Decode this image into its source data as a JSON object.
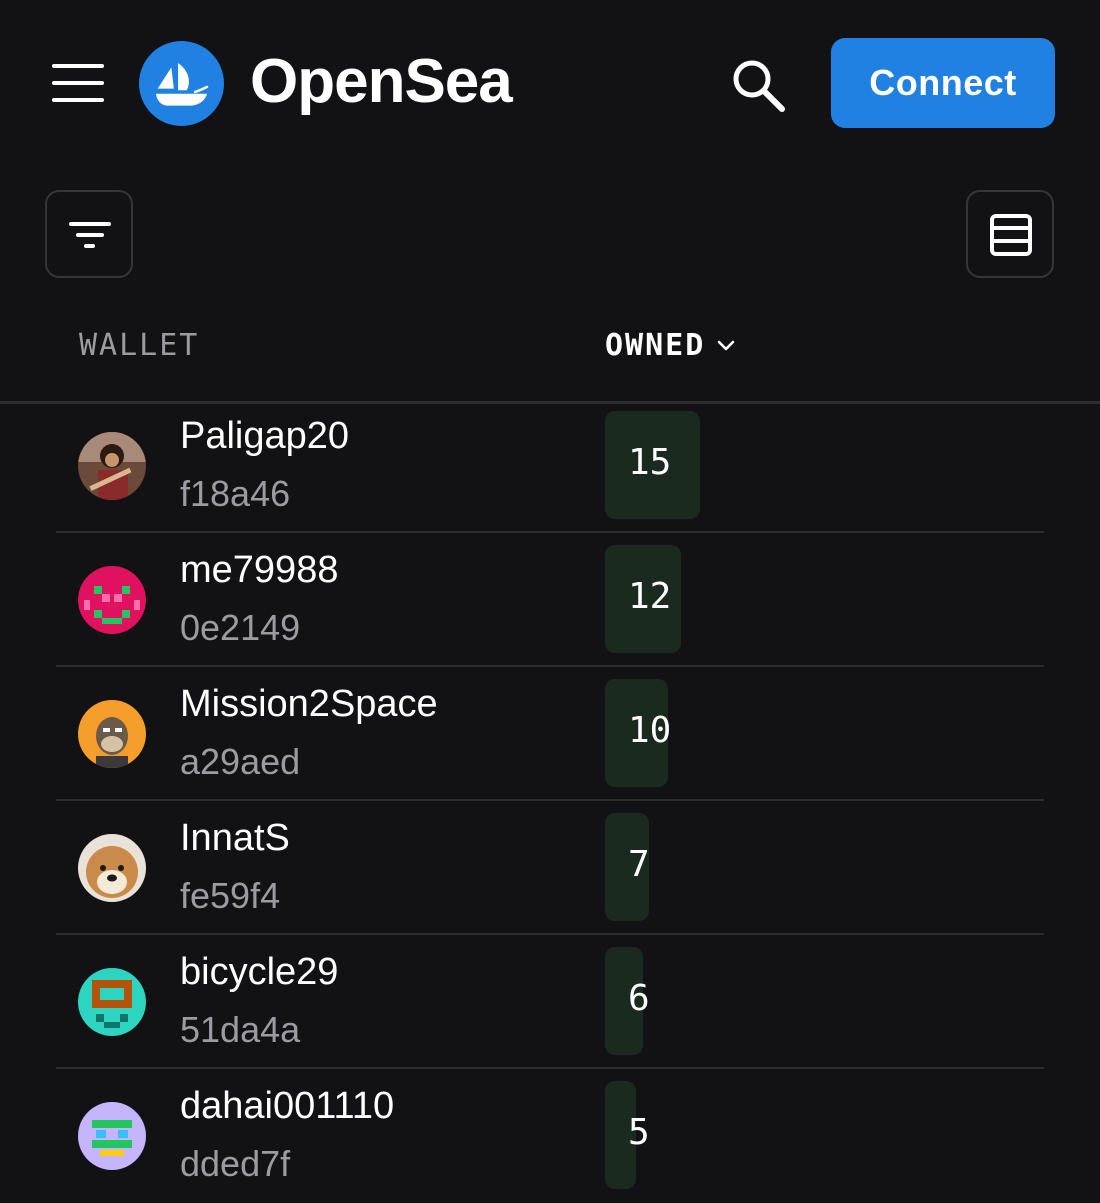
{
  "header": {
    "brand": "OpenSea",
    "connect_label": "Connect",
    "menu_icon": "hamburger-menu-icon",
    "logo_icon": "opensea-logo-icon",
    "search_icon": "search-icon",
    "brand_color": "#2081e2"
  },
  "toolbar": {
    "filter_icon": "filter-icon",
    "view_icon": "list-view-icon"
  },
  "table": {
    "col_wallet": "WALLET",
    "col_owned": "OWNED",
    "sort_icon": "chevron-down-icon",
    "max_owned": 15,
    "rows": [
      {
        "name": "Paligap20",
        "address": "f18a46",
        "owned": "15",
        "avatar": "guitarist-photo"
      },
      {
        "name": "me79988",
        "address": "0e2149",
        "owned": "12",
        "avatar": "pink-pixel-face"
      },
      {
        "name": "Mission2Space",
        "address": "a29aed",
        "owned": "10",
        "avatar": "ape-orange"
      },
      {
        "name": "InnatS",
        "address": "fe59f4",
        "owned": "7",
        "avatar": "shiba-dog"
      },
      {
        "name": "bicycle29",
        "address": "51da4a",
        "owned": "6",
        "avatar": "teal-pixel-face"
      },
      {
        "name": "dahai001110",
        "address": "dded7f",
        "owned": "5",
        "avatar": "lilac-pixel-face"
      }
    ]
  }
}
